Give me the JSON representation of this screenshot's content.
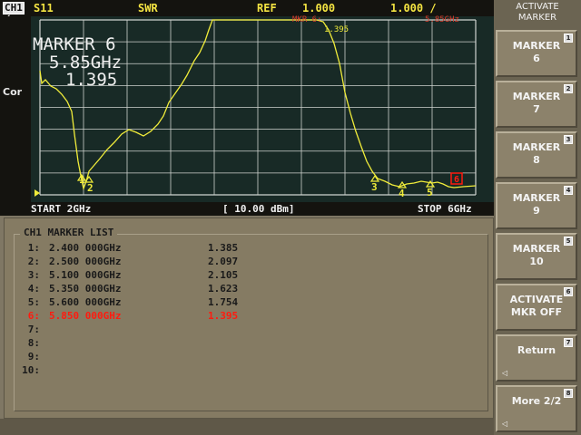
{
  "header": {
    "channel": "CH1",
    "channel_mark": "◢",
    "parameter": "S11",
    "format": "SWR",
    "ref_label": "REF",
    "ref_value": "1.000",
    "scale_value": "1.000 /"
  },
  "screen": {
    "correction": "Cor",
    "marker_readout_title": "MARKER 6",
    "marker_readout_freq": "5.85GHz",
    "marker_readout_value": "1.395",
    "ref_marker_note": "MKR 6:",
    "ref_marker_value": "1.395",
    "top_right_freq": "5.85GHz"
  },
  "status": {
    "start": "START 2GHz",
    "power": "[ 10.00 dBm]",
    "stop": "STOP 6GHz"
  },
  "marker_list": {
    "title": "CH1 MARKER LIST",
    "rows": [
      {
        "index": "1:",
        "freq": "2.400 000GHz",
        "value": "1.385"
      },
      {
        "index": "2:",
        "freq": "2.500 000GHz",
        "value": "2.097"
      },
      {
        "index": "3:",
        "freq": "5.100 000GHz",
        "value": "2.105"
      },
      {
        "index": "4:",
        "freq": "5.350 000GHz",
        "value": "1.623"
      },
      {
        "index": "5:",
        "freq": "5.600 000GHz",
        "value": "1.754"
      },
      {
        "index": "6:",
        "freq": "5.850 000GHz",
        "value": "1.395"
      },
      {
        "index": "7:",
        "freq": "",
        "value": ""
      },
      {
        "index": "8:",
        "freq": "",
        "value": ""
      },
      {
        "index": "9:",
        "freq": "",
        "value": ""
      },
      {
        "index": "10:",
        "freq": "",
        "value": ""
      }
    ]
  },
  "trace_markers": [
    "1",
    "2",
    "3",
    "4",
    "5",
    "6"
  ],
  "softkeys": {
    "title": "ACTIVATE\nMARKER",
    "keys": [
      {
        "label": "MARKER\n6",
        "num": "1",
        "arrow": ""
      },
      {
        "label": "MARKER\n7",
        "num": "2",
        "arrow": ""
      },
      {
        "label": "MARKER\n8",
        "num": "3",
        "arrow": ""
      },
      {
        "label": "MARKER\n9",
        "num": "4",
        "arrow": ""
      },
      {
        "label": "MARKER\n10",
        "num": "5",
        "arrow": ""
      },
      {
        "label": "ACTIVATE\nMKR OFF",
        "num": "6",
        "arrow": ""
      },
      {
        "label": "Return",
        "num": "7",
        "arrow": "◁"
      },
      {
        "label": "More 2/2",
        "num": "8",
        "arrow": "◁"
      }
    ]
  },
  "colors": {
    "trace": "#f0ec3a",
    "active_marker": "#ff1b0f",
    "screen_bg": "#182a26",
    "grid": "#dcdcdc"
  }
}
